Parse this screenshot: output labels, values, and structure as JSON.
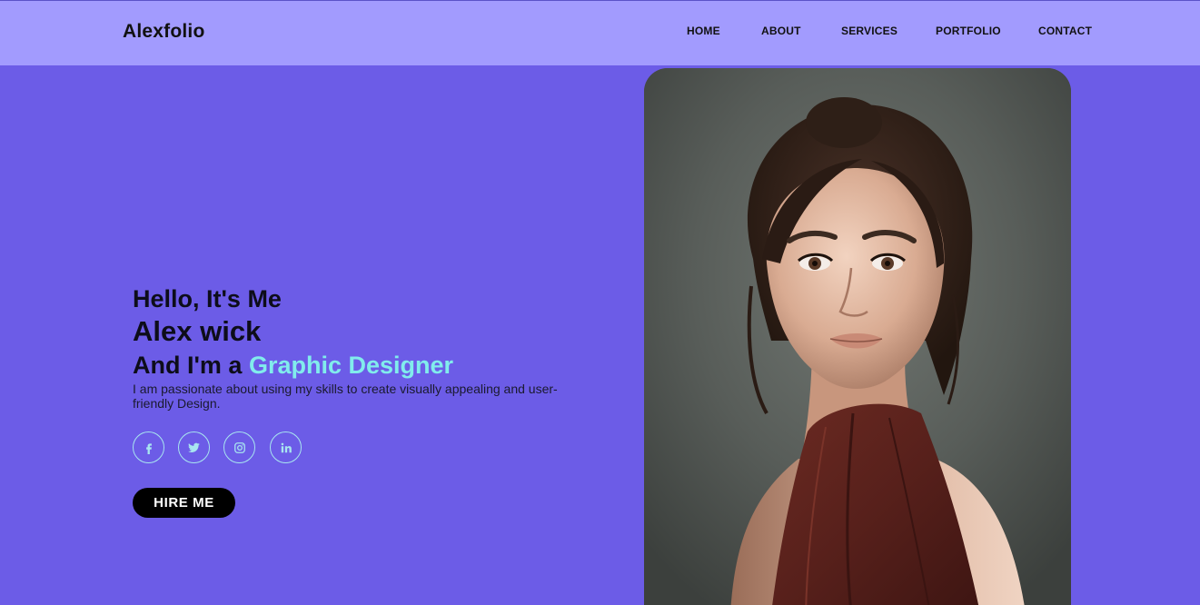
{
  "header": {
    "logo": "Alexfolio",
    "nav": {
      "home": "HOME",
      "about": "ABOUT",
      "services": "SERVICES",
      "portfolio": "PORTFOLIO",
      "contact": "CONTACT"
    }
  },
  "hero": {
    "greeting": "Hello, It's Me",
    "name": "Alex wick",
    "role_prefix": "And I'm a ",
    "role": "Graphic Designer",
    "description": "I am passionate about using my skills to create visually appealing and user-friendly Design.",
    "cta": "HIRE ME"
  },
  "socials": [
    {
      "icon": "facebook-icon"
    },
    {
      "icon": "twitter-icon"
    },
    {
      "icon": "instagram-icon"
    },
    {
      "icon": "linkedin-icon"
    }
  ],
  "colors": {
    "background": "#6c5ce7",
    "header": "#a29bfe",
    "accent": "#81ecec",
    "button": "#000000"
  }
}
